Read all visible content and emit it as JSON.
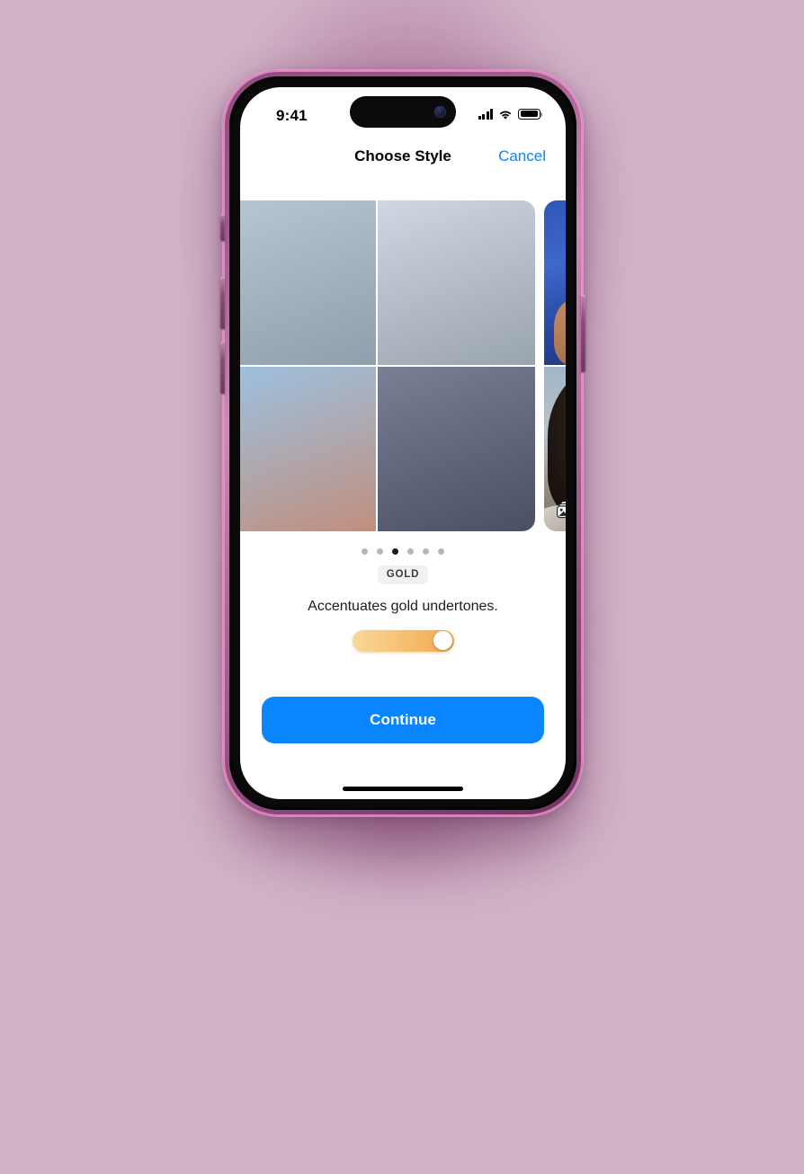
{
  "theme": {
    "page_background": "#d1b3c7",
    "phone_frame": "#8d4a7c",
    "accent_blue": "#0a84ff",
    "slider_gradient_from": "#f9d79a",
    "slider_gradient_to": "#f0a94e",
    "dot_active": "#1c1c1e",
    "dot_inactive": "#b6b6b9"
  },
  "status_bar": {
    "time": "9:41",
    "cellular_icon": "signal-bars-icon",
    "wifi_icon": "wifi-icon",
    "battery_icon": "battery-full-icon",
    "dynamic_island_camera": "camera-lens-icon"
  },
  "nav": {
    "title": "Choose Style",
    "cancel_label": "Cancel"
  },
  "carousel": {
    "photos_badge_icon": "photo-stack-icon",
    "active_index": 2,
    "dot_count": 6,
    "cards": [
      {
        "name": "previous-style-card",
        "tiles": [
          "peek-a",
          "peek-c",
          "peek-e",
          "peek-f"
        ]
      },
      {
        "name": "gold-style-card",
        "tiles": [
          "portrait-sunglasses-blue-wall",
          "portrait-cream-top-sky",
          "portrait-closeup-face",
          "portrait-striped-dress-blue-wall"
        ]
      },
      {
        "name": "next-style-card",
        "tiles": [
          "peek-c",
          "peek-b",
          "peek-e",
          "peek-d"
        ]
      }
    ]
  },
  "style_info": {
    "badge": "GOLD",
    "caption": "Accentuates gold undertones.",
    "slider": {
      "name": "intensity-slider",
      "value": 100,
      "min": 0,
      "max": 100
    }
  },
  "footer": {
    "continue_label": "Continue",
    "home_indicator": "home-indicator"
  }
}
